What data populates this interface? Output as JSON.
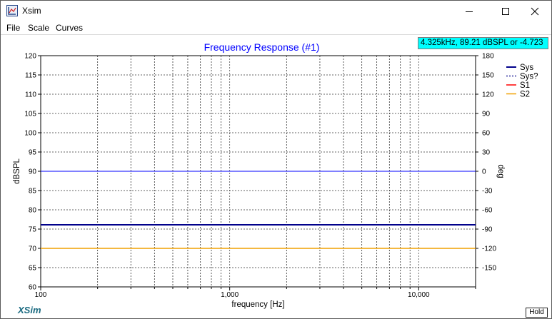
{
  "window": {
    "title": "Xsim",
    "icon": "xsim-app-icon",
    "controls": {
      "minimize": "minimize-icon",
      "maximize": "maximize-icon",
      "close": "close-icon"
    }
  },
  "menu": {
    "file": "File",
    "scale": "Scale",
    "curves": "Curves"
  },
  "cursor_readout": "4.325kHz, 89.21 dBSPL or -4.723",
  "logo": "XSim",
  "hold_label": "Hold",
  "colors": {
    "sys": "#00008b",
    "sys_q": "#3030a0",
    "s1": "#ff0000",
    "s2": "#f0a000",
    "hline": "#0000ff",
    "title": "#0000ff",
    "readout_bg": "#00ffff"
  },
  "chart_data": {
    "type": "line",
    "title": "Frequency Response (#1)",
    "xlabel": "frequency [Hz]",
    "ylabel": "dBSPL",
    "y2label": "deg",
    "xscale": "log",
    "xlim": [
      100,
      20000
    ],
    "ylim": [
      60,
      120
    ],
    "y2lim": [
      -180,
      180
    ],
    "grid": true,
    "legend_position": "top-right",
    "x_tick_labels": [
      {
        "value": 100,
        "label": "100"
      },
      {
        "value": 1000,
        "label": "1,000"
      },
      {
        "value": 10000,
        "label": "10,000"
      }
    ],
    "y_ticks": [
      60,
      65,
      70,
      75,
      80,
      85,
      90,
      95,
      100,
      105,
      110,
      115,
      120
    ],
    "y2_ticks": [
      -150,
      -120,
      -90,
      -60,
      -30,
      0,
      30,
      60,
      90,
      120,
      150,
      180
    ],
    "series": [
      {
        "name": "Sys",
        "style": "solid",
        "color": "#00008b",
        "x": [
          100,
          20000
        ],
        "y": [
          76.1,
          76.1
        ]
      },
      {
        "name": "Sys?",
        "style": "dashed",
        "color": "#3030a0",
        "x": [],
        "y": []
      },
      {
        "name": "S1",
        "style": "solid",
        "color": "#ff0000",
        "x": [],
        "y": []
      },
      {
        "name": "S2",
        "style": "solid",
        "color": "#f0a000",
        "x": [
          100,
          20000
        ],
        "y": [
          70,
          70
        ]
      }
    ],
    "reference_lines": [
      {
        "axis": "y",
        "value": 90,
        "color": "#0000ff"
      }
    ]
  }
}
